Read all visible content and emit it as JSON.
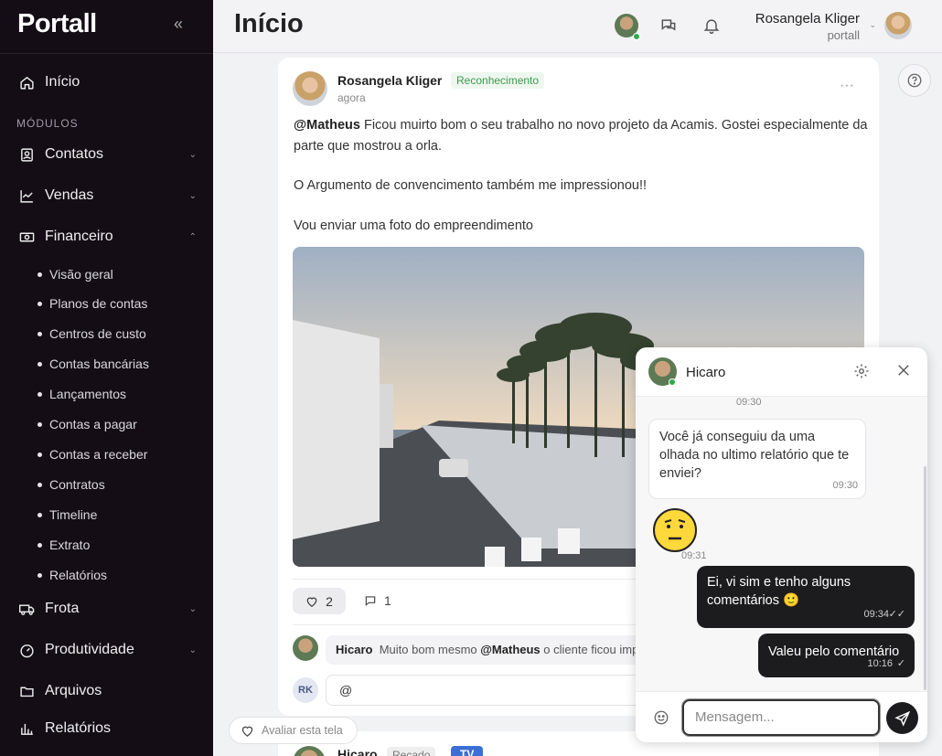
{
  "app": {
    "logo": "Portall",
    "collapse_icon": "double-chevron-left-icon"
  },
  "sidebar": {
    "home": "Início",
    "section": "MÓDULOS",
    "modules": [
      {
        "label": "Contatos",
        "icon": "contacts-icon"
      },
      {
        "label": "Vendas",
        "icon": "chart-icon"
      },
      {
        "label": "Financeiro",
        "icon": "money-icon"
      }
    ],
    "financeiro_items": [
      "Visão geral",
      "Planos de contas",
      "Centros de custo",
      "Contas bancárias",
      "Lançamentos",
      "Contas a pagar",
      "Contas a receber",
      "Contratos",
      "Timeline",
      "Extrato",
      "Relatórios"
    ],
    "bottom_modules": [
      {
        "label": "Frota",
        "icon": "truck-icon"
      },
      {
        "label": "Produtividade",
        "icon": "gauge-icon"
      },
      {
        "label": "Arquivos",
        "icon": "folder-icon"
      },
      {
        "label": "Relatórios",
        "icon": "bar-chart-icon"
      }
    ]
  },
  "header": {
    "title": "Início",
    "user_name": "Rosangela Kliger",
    "user_company": "portall"
  },
  "post": {
    "author": "Rosangela Kliger",
    "badge": "Reconhecimento",
    "time": "agora",
    "mention": "@Matheus",
    "line1": " Ficou muirto bom o seu trabalho no novo projeto da Acamis. Gostei especialmente da parte que mostrou a orla.",
    "line2": "O Argumento de convencimento também me impressionou!!",
    "line3": "Vou enviar uma foto do empreendimento",
    "likes": "2",
    "comments": "1",
    "comment_author": "Hicaro",
    "comment_text_pre": "Muito bom mesmo ",
    "comment_mention": "@Matheus",
    "comment_text_post": " o cliente ficou impressionado",
    "my_initials": "RK",
    "reply_value": "@"
  },
  "next_post": {
    "author": "Hicaro",
    "badge1": "Recado",
    "badge2": "TV"
  },
  "rate": {
    "label": "Avaliar esta tela"
  },
  "chat": {
    "name": "Hicaro",
    "time_top": "09:30",
    "msg1": "Você já conseguiu da uma olhada no ultimo relatório que te enviei?",
    "msg1_time": "09:30",
    "emoji_time": "09:31",
    "msg2": "Ei, vi sim e tenho alguns comentários 🙂",
    "msg2_time": "09:34",
    "msg3": "Valeu pelo comentário",
    "msg3_time": "10:16",
    "placeholder": "Mensagem..."
  },
  "colors": {
    "sidebar": "#140d16",
    "badge_green": "#3d9a4f",
    "dark_bubble": "#1c1c1e"
  }
}
